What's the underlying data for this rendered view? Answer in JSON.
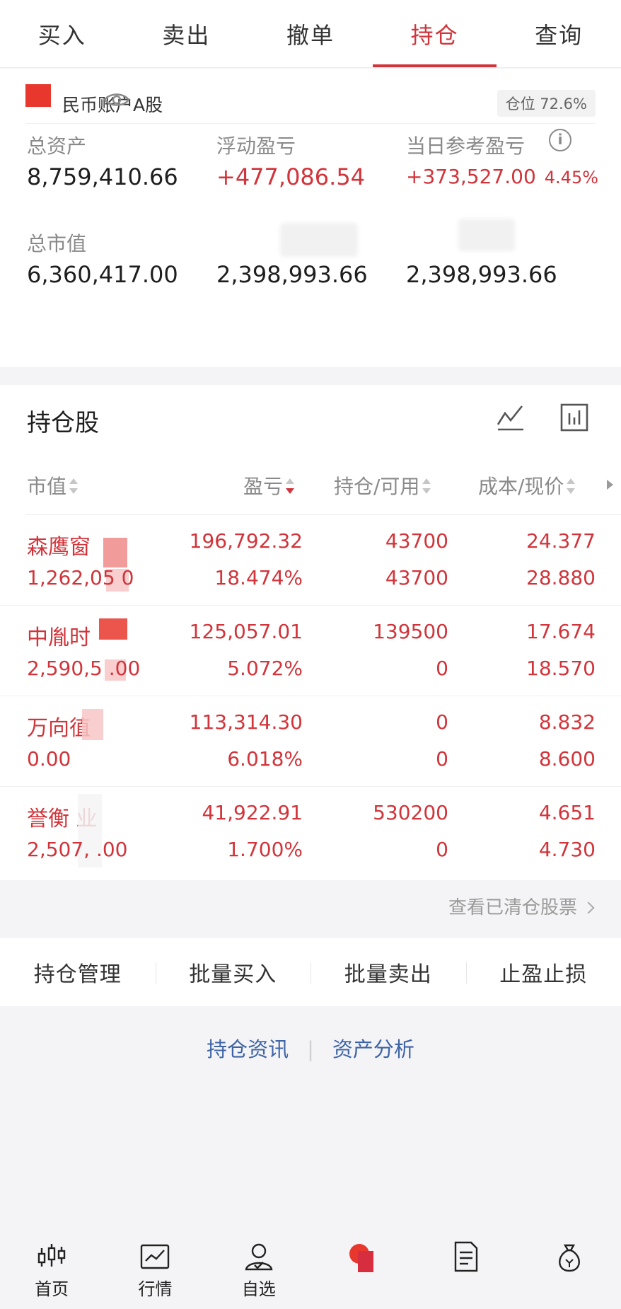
{
  "tabs": [
    {
      "label": "买入"
    },
    {
      "label": "卖出"
    },
    {
      "label": "撤单"
    },
    {
      "label": "持仓",
      "active": true
    },
    {
      "label": "查询"
    }
  ],
  "account": {
    "name": "民币账户A股",
    "position_label": "仓位 72.6%"
  },
  "metrics": {
    "total_assets_label": "总资产",
    "total_assets": "8,759,410.66",
    "floating_pl_label": "浮动盈亏",
    "floating_pl": "+477,086.54",
    "daily_pl_label": "当日参考盈亏",
    "daily_pl": "+373,527.00",
    "daily_pl_pct": "4.45%",
    "market_value_label": "总市值",
    "market_value": "6,360,417.00",
    "col2_value": "2,398,993.66",
    "col3_value": "2,398,993.66"
  },
  "holdings": {
    "title": "持仓股",
    "headers": {
      "market_value": "市值",
      "pl": "盈亏",
      "position": "持仓/可用",
      "cost": "成本/现价"
    },
    "rows": [
      {
        "name": "森鹰窗",
        "market_value": "1,262,05  0",
        "pl": "196,792.32",
        "pl_pct": "18.474%",
        "position": "43700",
        "available": "43700",
        "cost": "24.377",
        "price": "28.880"
      },
      {
        "name": "中胤时",
        "market_value": "2,590,5  .00",
        "pl": "125,057.01",
        "pl_pct": "5.072%",
        "position": "139500",
        "available": "0",
        "cost": "17.674",
        "price": "18.570"
      },
      {
        "name": "万向徝  ",
        "market_value": "0.00",
        "pl": "113,314.30",
        "pl_pct": "6.018%",
        "position": "0",
        "available": "0",
        "cost": "8.832",
        "price": "8.600"
      },
      {
        "name": "誉衡  业",
        "market_value": "2,507,  .00",
        "pl": "41,922.91",
        "pl_pct": "1.700%",
        "position": "530200",
        "available": "0",
        "cost": "4.651",
        "price": "4.730"
      }
    ],
    "cleared_link": "查看已清仓股票"
  },
  "actions": [
    "持仓管理",
    "批量买入",
    "批量卖出",
    "止盈止损"
  ],
  "links": {
    "holdings_news": "持仓资讯",
    "asset_analysis": "资产分析"
  },
  "nav": [
    {
      "label": "首页",
      "icon": "candlestick-icon"
    },
    {
      "label": "行情",
      "icon": "market-chart-icon"
    },
    {
      "label": "自选",
      "icon": "watchlist-user-icon"
    },
    {
      "label": "",
      "icon": "trade-icon"
    },
    {
      "label": "",
      "icon": "document-icon"
    },
    {
      "label": "",
      "icon": "money-bag-icon"
    }
  ],
  "colors": {
    "accent_red": "#d1343a",
    "link_blue": "#3e64a6",
    "muted_gray": "#8a8a8a"
  }
}
